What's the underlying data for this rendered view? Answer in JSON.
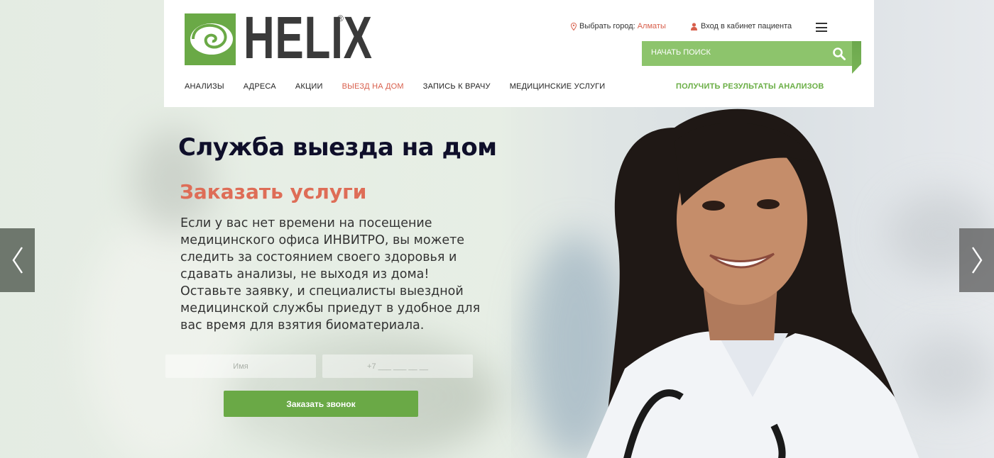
{
  "header": {
    "logo_text": "HELIX",
    "logo_reg": "®",
    "city_label": "Выбрать город:",
    "city_value": "Алматы",
    "cabinet_link": "Вход в кабинет пациента",
    "search_placeholder": "НАЧАТЬ ПОИСК"
  },
  "nav": {
    "items": [
      {
        "label": "АНАЛИЗЫ"
      },
      {
        "label": "АДРЕСА"
      },
      {
        "label": "АКЦИИ"
      },
      {
        "label": "ВЫЕЗД НА ДОМ",
        "active": true
      },
      {
        "label": "ЗАПИСЬ К ВРАЧУ"
      },
      {
        "label": "МЕДИЦИНСКИЕ УСЛУГИ"
      }
    ],
    "results_link": "ПОЛУЧИТЬ РЕЗУЛЬТАТЫ АНАЛИЗОВ"
  },
  "hero": {
    "title": "Служба выезда на дом",
    "subtitle": "Заказать услуги",
    "description": "Если у вас нет времени на посещение медицинского офиса ИНВИТРО, вы можете следить за состоянием своего здоровья и сдавать анализы, не выходя из дома! Оставьте заявку, и специалисты выездной медицинской службы приедут в удобное для вас время для взятия биоматериала.",
    "name_placeholder": "Имя",
    "phone_placeholder": "+7 ___ ___ __ __",
    "order_button": "Заказать звонок"
  },
  "colors": {
    "brand_green": "#6aa946",
    "search_green": "#8dc46c",
    "accent_red": "#de6d57",
    "title_dark": "#0f0f2a"
  },
  "icons": {
    "location": "map-pin-icon",
    "user": "user-icon",
    "menu": "hamburger-menu-icon",
    "search": "search-icon",
    "prev": "chevron-left-icon",
    "next": "chevron-right-icon"
  }
}
